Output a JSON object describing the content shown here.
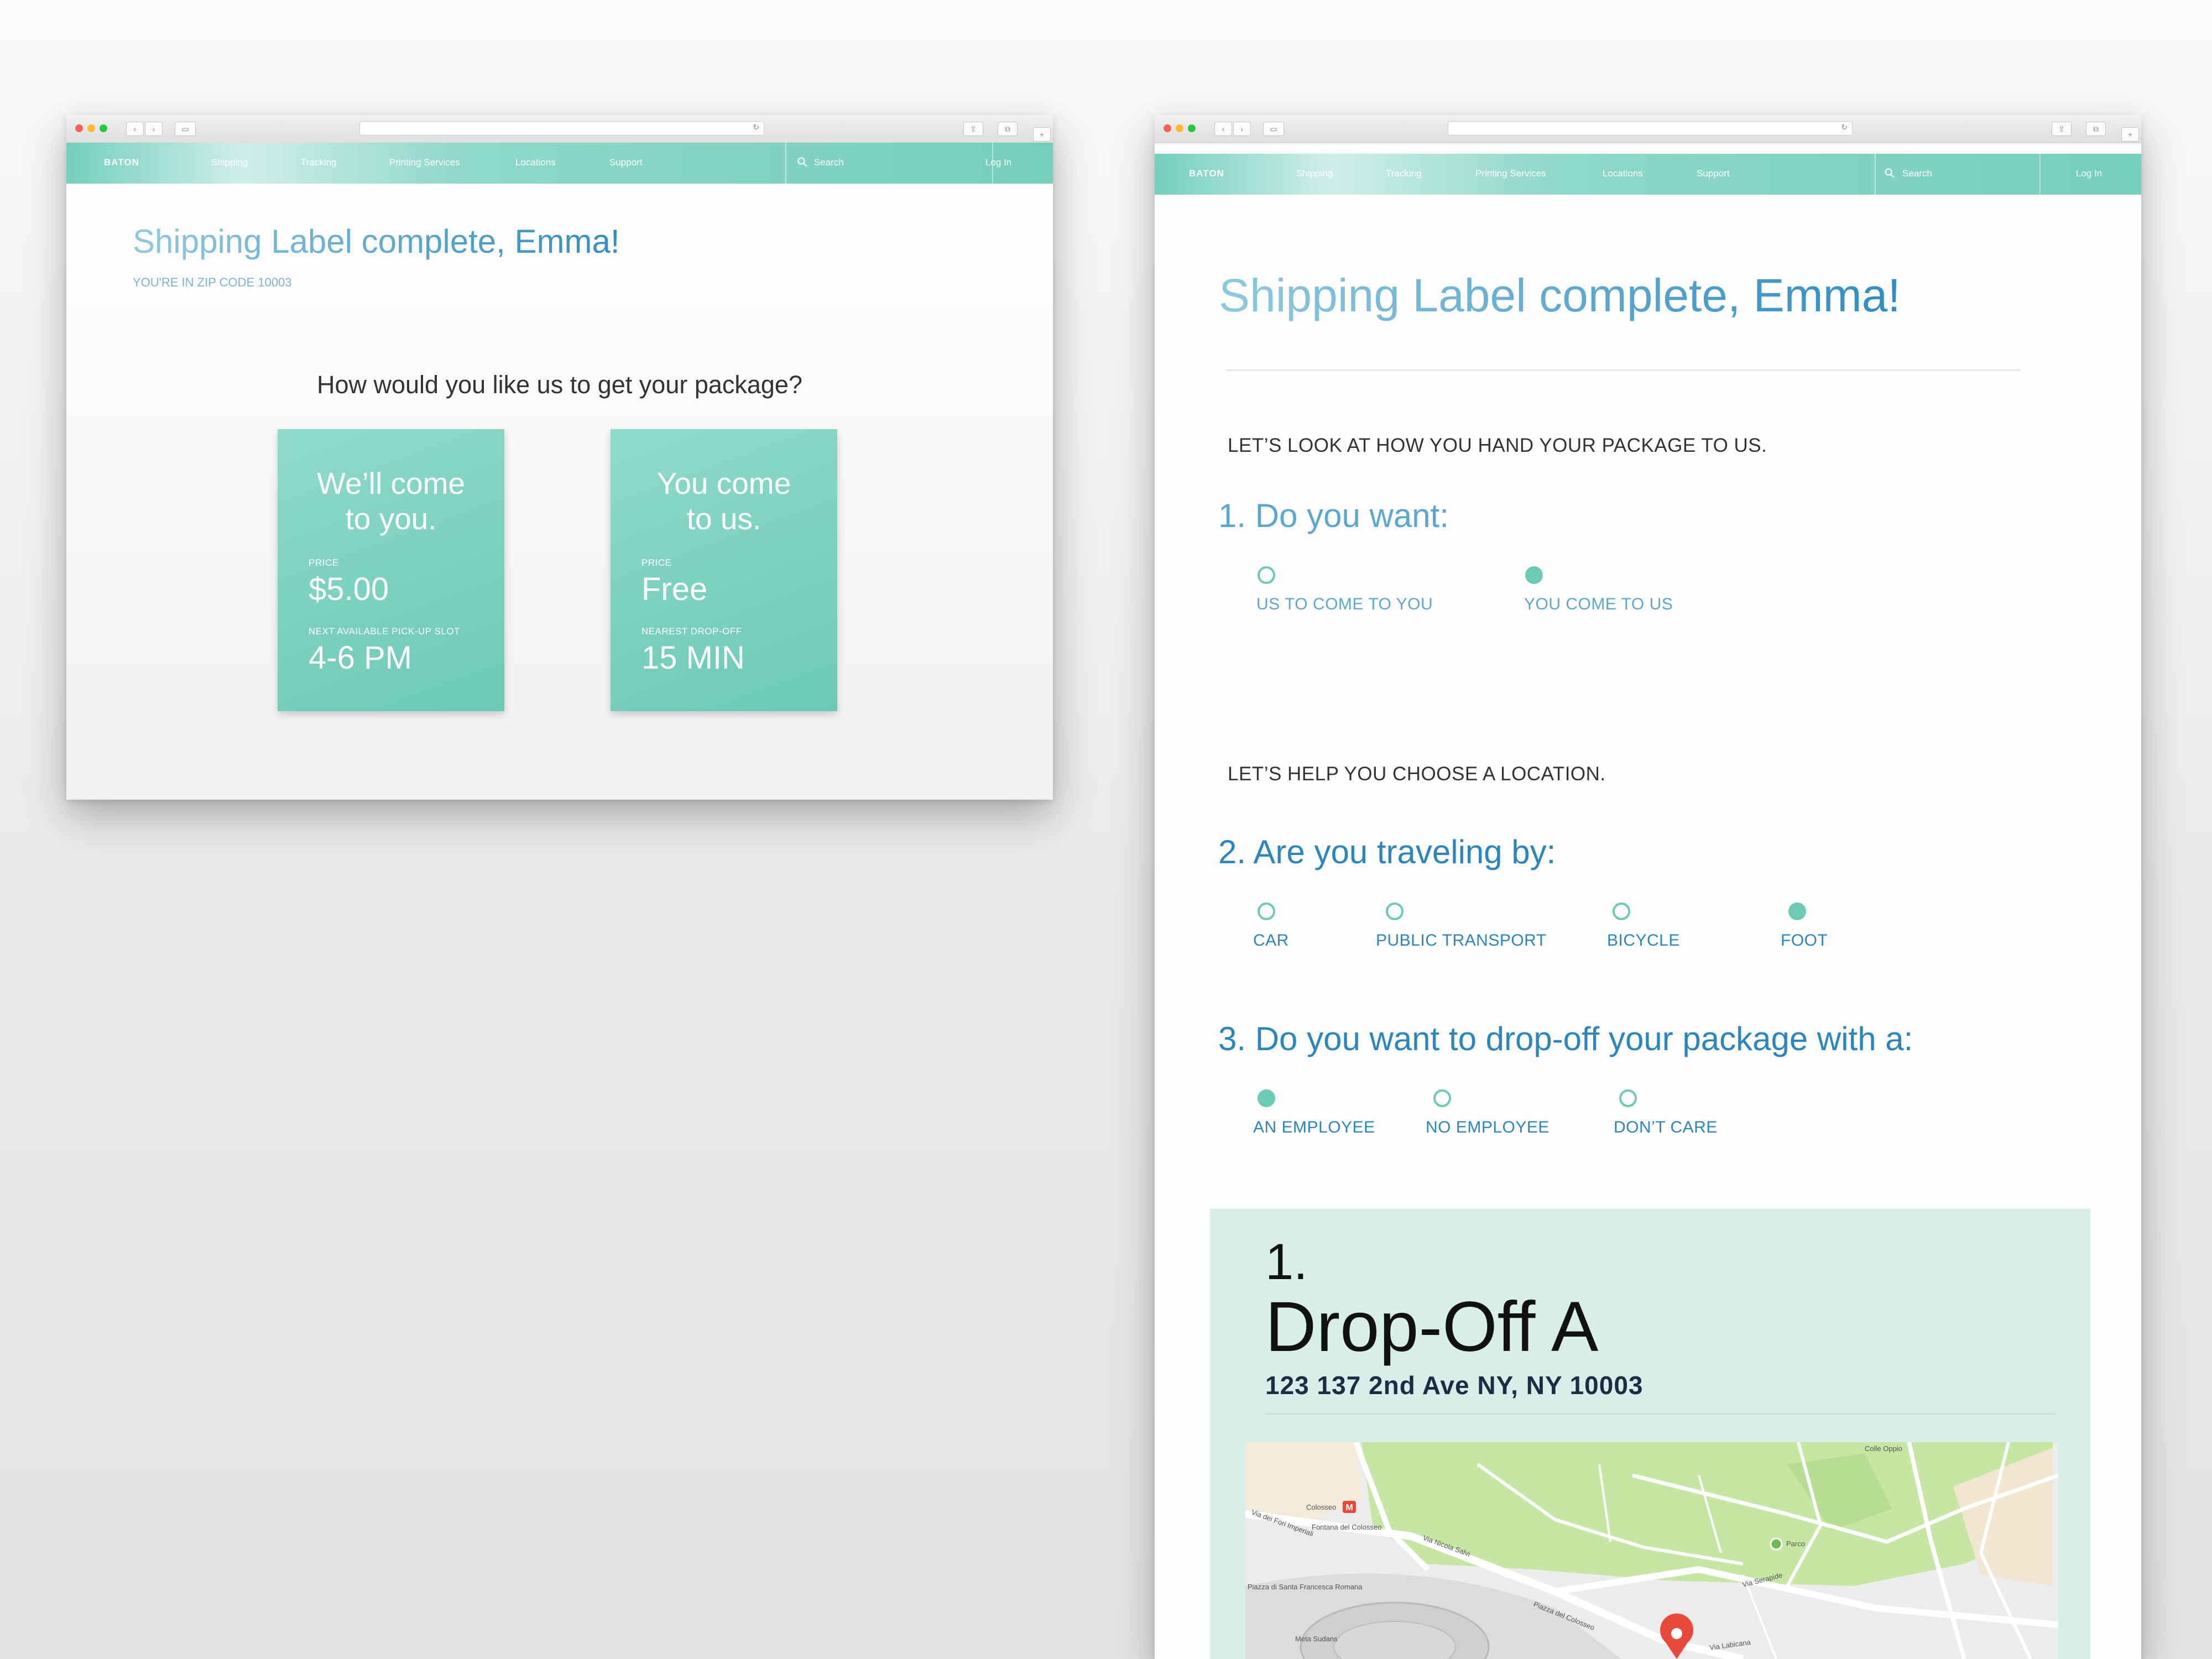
{
  "left_window": {
    "nav": {
      "brand": "BATON",
      "items": [
        "Shipping",
        "Tracking",
        "Printing Services",
        "Locations",
        "Support"
      ],
      "search": "Search",
      "login": "Log In"
    },
    "title": "Shipping Label complete, Emma!",
    "zip_line": "YOU'RE IN ZIP CODE 10003",
    "question": "How would you like us to get your package?",
    "cards": [
      {
        "title_line1": "We’ll come",
        "title_line2": "to you.",
        "price_label": "PRICE",
        "price": "$5.00",
        "slot_label": "NEXT AVAILABLE PICK-UP SLOT",
        "slot": "4-6 PM"
      },
      {
        "title_line1": "You come",
        "title_line2": "to us.",
        "price_label": "PRICE",
        "price": "Free",
        "slot_label": "NEAREST DROP-OFF",
        "slot": "15 MIN"
      }
    ]
  },
  "right_window": {
    "nav": {
      "brand": "BATON",
      "items": [
        "Shipping",
        "Tracking",
        "Printing Services",
        "Locations",
        "Support"
      ],
      "search": "Search",
      "login": "Log In"
    },
    "title": "Shipping Label complete, Emma!",
    "section1": "LET’S LOOK AT HOW YOU HAND YOUR PACKAGE TO US.",
    "q1": {
      "heading": "1. Do you want:",
      "options": [
        {
          "label": "US TO COME TO YOU",
          "selected": false
        },
        {
          "label": "YOU COME TO US",
          "selected": true
        }
      ]
    },
    "section2": "LET’S HELP YOU CHOOSE A LOCATION.",
    "q2": {
      "heading": "2. Are you traveling by:",
      "options": [
        {
          "label": "CAR",
          "selected": false
        },
        {
          "label": "PUBLIC TRANSPORT",
          "selected": false
        },
        {
          "label": "BICYCLE",
          "selected": false
        },
        {
          "label": "FOOT",
          "selected": true
        }
      ]
    },
    "q3": {
      "heading": "3. Do you want to drop-off your package with a:",
      "options": [
        {
          "label": "AN EMPLOYEE",
          "selected": true
        },
        {
          "label": "NO EMPLOYEE",
          "selected": false
        },
        {
          "label": "DON’T CARE",
          "selected": false
        }
      ]
    },
    "dropoff": {
      "number": "1.",
      "name": "Drop-Off A",
      "address": "123 137 2nd Ave NY, NY 10003",
      "map_labels": [
        "Colosseo",
        "Fontana del Colosseo",
        "Piazza del Colosseo",
        "Via dei Fori Imperiali",
        "Colle Oppio",
        "Parco",
        "Via Nicola Salvi",
        "Via Labicana",
        "Via Serapide",
        "Piazza di Santa Francesca Romana",
        "Meta Sudans"
      ]
    }
  },
  "colors": {
    "accent_teal": "#6ccbb6",
    "accent_blue": "#2a86c0",
    "panel_bg": "#d8eee8",
    "map_pin": "#e8493b",
    "park_green": "#c6e7a4"
  },
  "icons": [
    "search-icon",
    "map-pin-icon",
    "metro-icon"
  ]
}
